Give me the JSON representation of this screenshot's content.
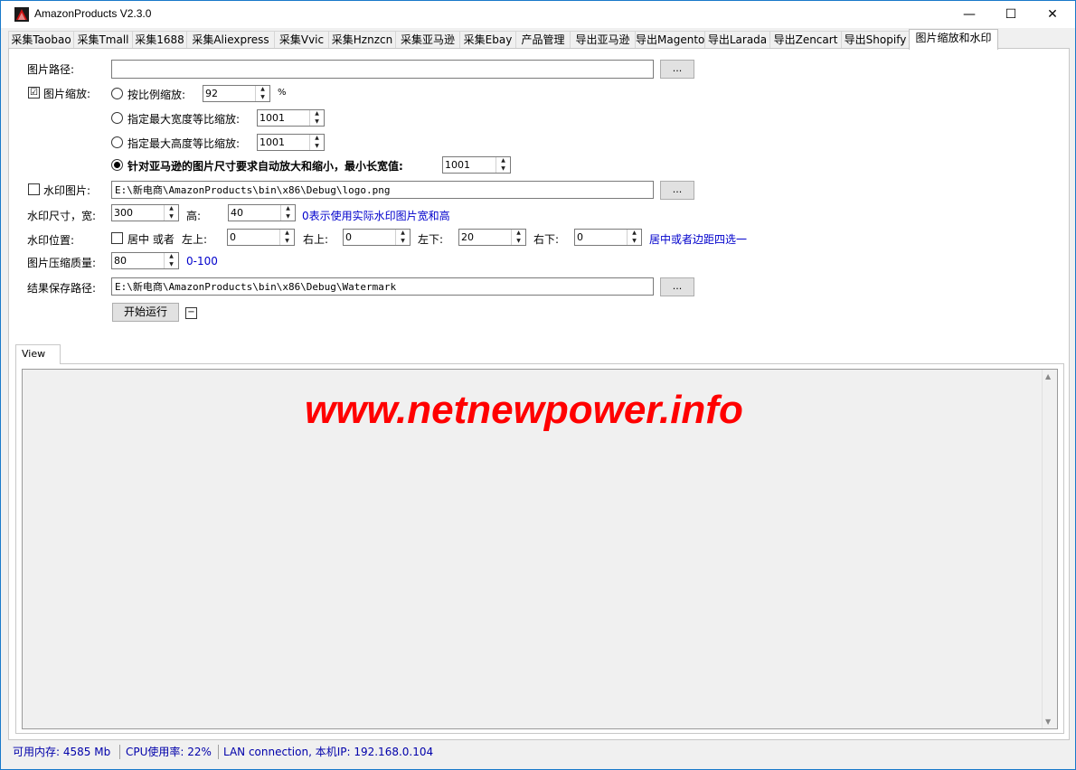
{
  "window": {
    "title": "AmazonProducts V2.3.0",
    "minimize": "—",
    "maximize": "☐",
    "close": "✕"
  },
  "tabs": [
    {
      "label": "采集Taobao"
    },
    {
      "label": "采集Tmall"
    },
    {
      "label": "采集1688"
    },
    {
      "label": "采集Aliexpress"
    },
    {
      "label": "采集Vvic"
    },
    {
      "label": "采集Hznzcn"
    },
    {
      "label": "采集亚马逊"
    },
    {
      "label": "采集Ebay"
    },
    {
      "label": "产品管理"
    },
    {
      "label": "导出亚马逊"
    },
    {
      "label": "导出Magento"
    },
    {
      "label": "导出Larada"
    },
    {
      "label": "导出Zencart"
    },
    {
      "label": "导出Shopify"
    },
    {
      "label": "图片缩放和水印"
    }
  ],
  "form": {
    "image_path_label": "图片路径:",
    "image_path_value": "",
    "browse_label": "...",
    "scale_checkbox_label": "图片缩放:",
    "scale_checked": "☑",
    "ratio_label": "按比例缩放:",
    "ratio_value": "92",
    "ratio_unit": "%",
    "max_width_label": "指定最大宽度等比缩放:",
    "max_width_value": "1001",
    "max_height_label": "指定最大高度等比缩放:",
    "max_height_value": "1001",
    "amazon_label": "针对亚马逊的图片尺寸要求自动放大和缩小，最小长宽值:",
    "amazon_value": "1001",
    "watermark_label": "水印图片:",
    "watermark_path": "E:\\新电商\\AmazonProducts\\bin\\x86\\Debug\\logo.png",
    "wm_size_label": "水印尺寸，宽:",
    "wm_width": "300",
    "wm_height_label": "高:",
    "wm_height": "40",
    "wm_size_hint": "0表示使用实际水印图片宽和高",
    "wm_pos_label": "水印位置:",
    "center_label": "居中 或者",
    "top_left_label": "左上:",
    "top_left": "0",
    "top_right_label": "右上:",
    "top_right": "0",
    "bottom_left_label": "左下:",
    "bottom_left": "20",
    "bottom_right_label": "右下:",
    "bottom_right": "0",
    "pos_hint": "居中或者边距四选一",
    "quality_label": "图片压缩质量:",
    "quality": "80",
    "quality_hint": "0-100",
    "save_path_label": "结果保存路径:",
    "save_path": "E:\\新电商\\AmazonProducts\\bin\\x86\\Debug\\Watermark",
    "start_label": "开始运行",
    "collapse_label": "−"
  },
  "view": {
    "tab_label": "View",
    "watermark_text": "www.netnewpower.info"
  },
  "status": {
    "memory": "可用内存: 4585 Mb",
    "cpu": "CPU使用率: 22%",
    "network": "LAN connection, 本机IP: 192.168.0.104"
  },
  "colors": {
    "accent": "#1979ca",
    "hint_blue": "#0000cc",
    "watermark_red": "#ff0000"
  }
}
